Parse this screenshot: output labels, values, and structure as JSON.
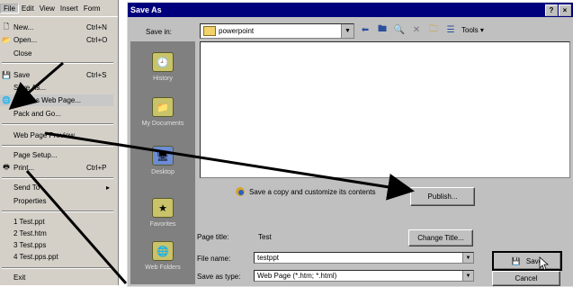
{
  "menubar": {
    "items": [
      "File",
      "Edit",
      "View",
      "Insert",
      "Form"
    ]
  },
  "filemenu": {
    "items": [
      {
        "label": "New...",
        "shortcut": "Ctrl+N",
        "icon": "new-doc-icon"
      },
      {
        "label": "Open...",
        "shortcut": "Ctrl+O",
        "icon": "open-folder-icon"
      },
      {
        "label": "Close",
        "shortcut": ""
      },
      {
        "label": "Save",
        "shortcut": "Ctrl+S",
        "icon": "floppy-icon"
      },
      {
        "label": "Save As...",
        "shortcut": ""
      },
      {
        "label": "Save as Web Page...",
        "shortcut": "",
        "icon": "web-page-icon"
      },
      {
        "label": "Pack and Go...",
        "shortcut": ""
      },
      {
        "label": "Web Page Preview",
        "shortcut": ""
      },
      {
        "label": "Page Setup...",
        "shortcut": ""
      },
      {
        "label": "Print...",
        "shortcut": "Ctrl+P",
        "icon": "printer-icon"
      },
      {
        "label": "Send To",
        "shortcut": "▸"
      },
      {
        "label": "Properties",
        "shortcut": ""
      },
      {
        "label": "1 Test.ppt",
        "shortcut": ""
      },
      {
        "label": "2 Test.htm",
        "shortcut": ""
      },
      {
        "label": "3 Test.pps",
        "shortcut": ""
      },
      {
        "label": "4 Test.pps.ppt",
        "shortcut": ""
      },
      {
        "label": "Exit",
        "shortcut": ""
      }
    ]
  },
  "dialog": {
    "title": "Save As",
    "title_buttons": [
      "?",
      "×"
    ],
    "save_in_label": "Save in:",
    "save_in_value": "powerpoint",
    "tools_label": "Tools ▾",
    "places": [
      "History",
      "My Documents",
      "Desktop",
      "Favorites",
      "Web Folders"
    ],
    "web_text": "Save a copy and customize its contents",
    "publish_button": "Publish...",
    "page_title_label": "Page title:",
    "page_title_value": "Test",
    "change_title_button": "Change Title...",
    "file_name_label": "File name:",
    "file_name_value": "testppt",
    "save_as_type_label": "Save as type:",
    "save_as_type_value": "Web Page (*.htm; *.html)",
    "save_button": "Save",
    "cancel_button": "Cancel"
  }
}
